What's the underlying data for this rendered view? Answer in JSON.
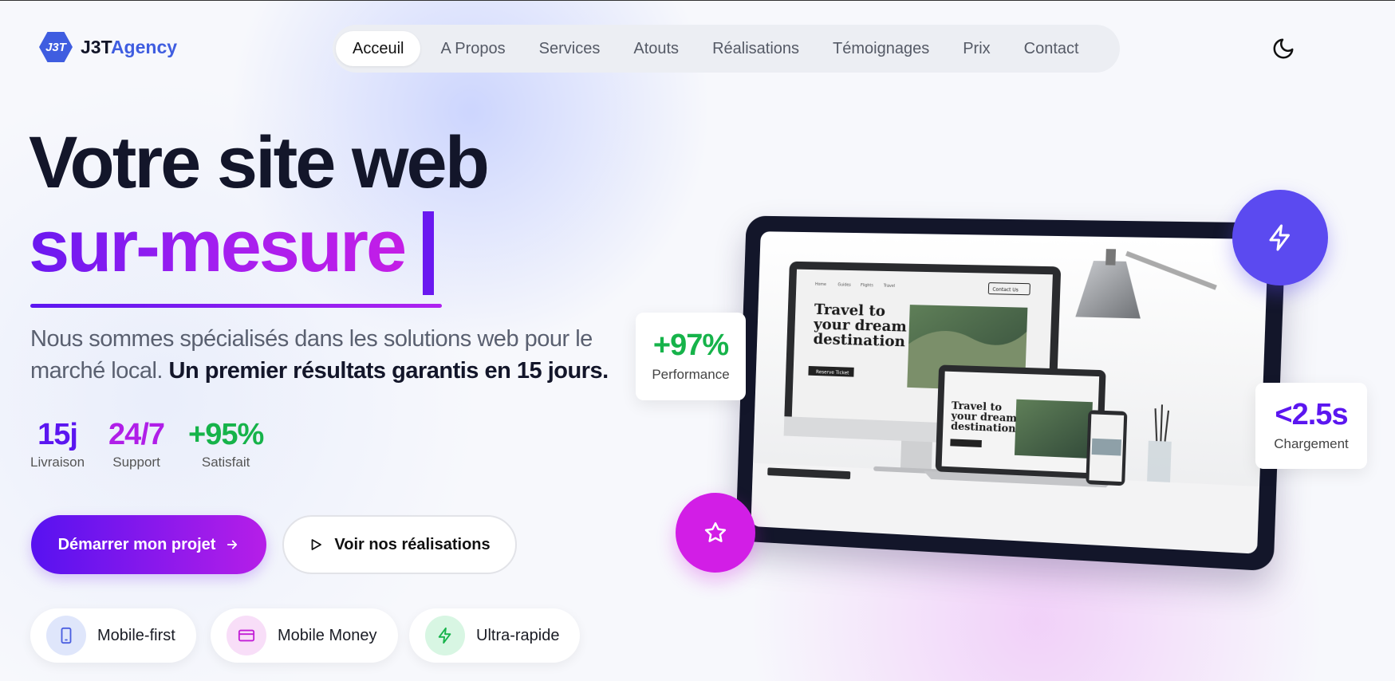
{
  "colors": {
    "brand_blue": "#3f5de0",
    "accent_purple": "#6a18f0",
    "accent_magenta": "#c41ee6",
    "green": "#16b34a",
    "bolt_circle": "#5b4af0",
    "star_circle": "#d21ee6"
  },
  "brand": {
    "logo_mark": "J3T",
    "name_part1": "J3T",
    "name_part2": "Agency"
  },
  "nav": {
    "items": [
      {
        "label": "Acceuil",
        "active": true
      },
      {
        "label": "A Propos"
      },
      {
        "label": "Services"
      },
      {
        "label": "Atouts"
      },
      {
        "label": "Réalisations"
      },
      {
        "label": "Témoignages"
      },
      {
        "label": "Prix"
      },
      {
        "label": "Contact"
      }
    ],
    "theme_toggle_icon": "moon-icon"
  },
  "hero": {
    "title_line1": "Votre site web",
    "title_line2": "sur-mesure",
    "subtitle_plain": "Nous sommes spécialisés dans les solutions web pour le marché local. ",
    "subtitle_bold": "Un premier résultats garantis en 15 jours."
  },
  "stats": [
    {
      "value": "15j",
      "label": "Livraison",
      "color": "#5b16f0"
    },
    {
      "value": "24/7",
      "label": "Support",
      "color": "#b01ee8"
    },
    {
      "value": "+95%",
      "label": "Satisfait",
      "color": "#16b34a"
    }
  ],
  "buttons": {
    "primary": {
      "label": "Démarrer mon projet",
      "icon": "arrow-right-icon"
    },
    "secondary": {
      "label": "Voir nos réalisations",
      "icon": "play-icon"
    }
  },
  "features": [
    {
      "label": "Mobile-first",
      "icon": "smartphone-icon"
    },
    {
      "label": "Mobile Money",
      "icon": "credit-card-icon"
    },
    {
      "label": "Ultra-rapide",
      "icon": "lightning-icon"
    }
  ],
  "visual": {
    "performance": {
      "value": "+97%",
      "label": "Performance"
    },
    "loading": {
      "value": "<2.5s",
      "label": "Chargement"
    },
    "mockup": {
      "headline_line1": "Travel to",
      "headline_line2": "your dream",
      "headline_line3": "destination",
      "cta": "Reserve Ticket",
      "contact": "Contact Us",
      "menu": [
        "Home",
        "Guides",
        "Flights",
        "Travel"
      ]
    },
    "bolt_icon": "lightning-icon",
    "star_icon": "star-icon"
  }
}
